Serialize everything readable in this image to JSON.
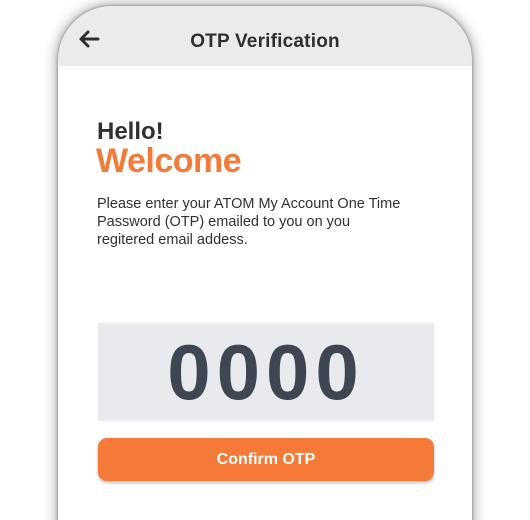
{
  "header": {
    "title": "OTP Verification",
    "back_icon": "arrow-left-icon"
  },
  "greeting": {
    "hello": "Hello!",
    "welcome": "Welcome"
  },
  "instructions": "Please enter your ATOM My Account One Time Password (OTP) emailed to you on you regitered email addess.",
  "otp": {
    "value": "0000"
  },
  "actions": {
    "confirm_label": "Confirm OTP"
  },
  "colors": {
    "accent": "#f57a38",
    "text_dark": "#2d3035",
    "otp_box_bg": "#e9eaed",
    "otp_digits": "#3e4651"
  }
}
